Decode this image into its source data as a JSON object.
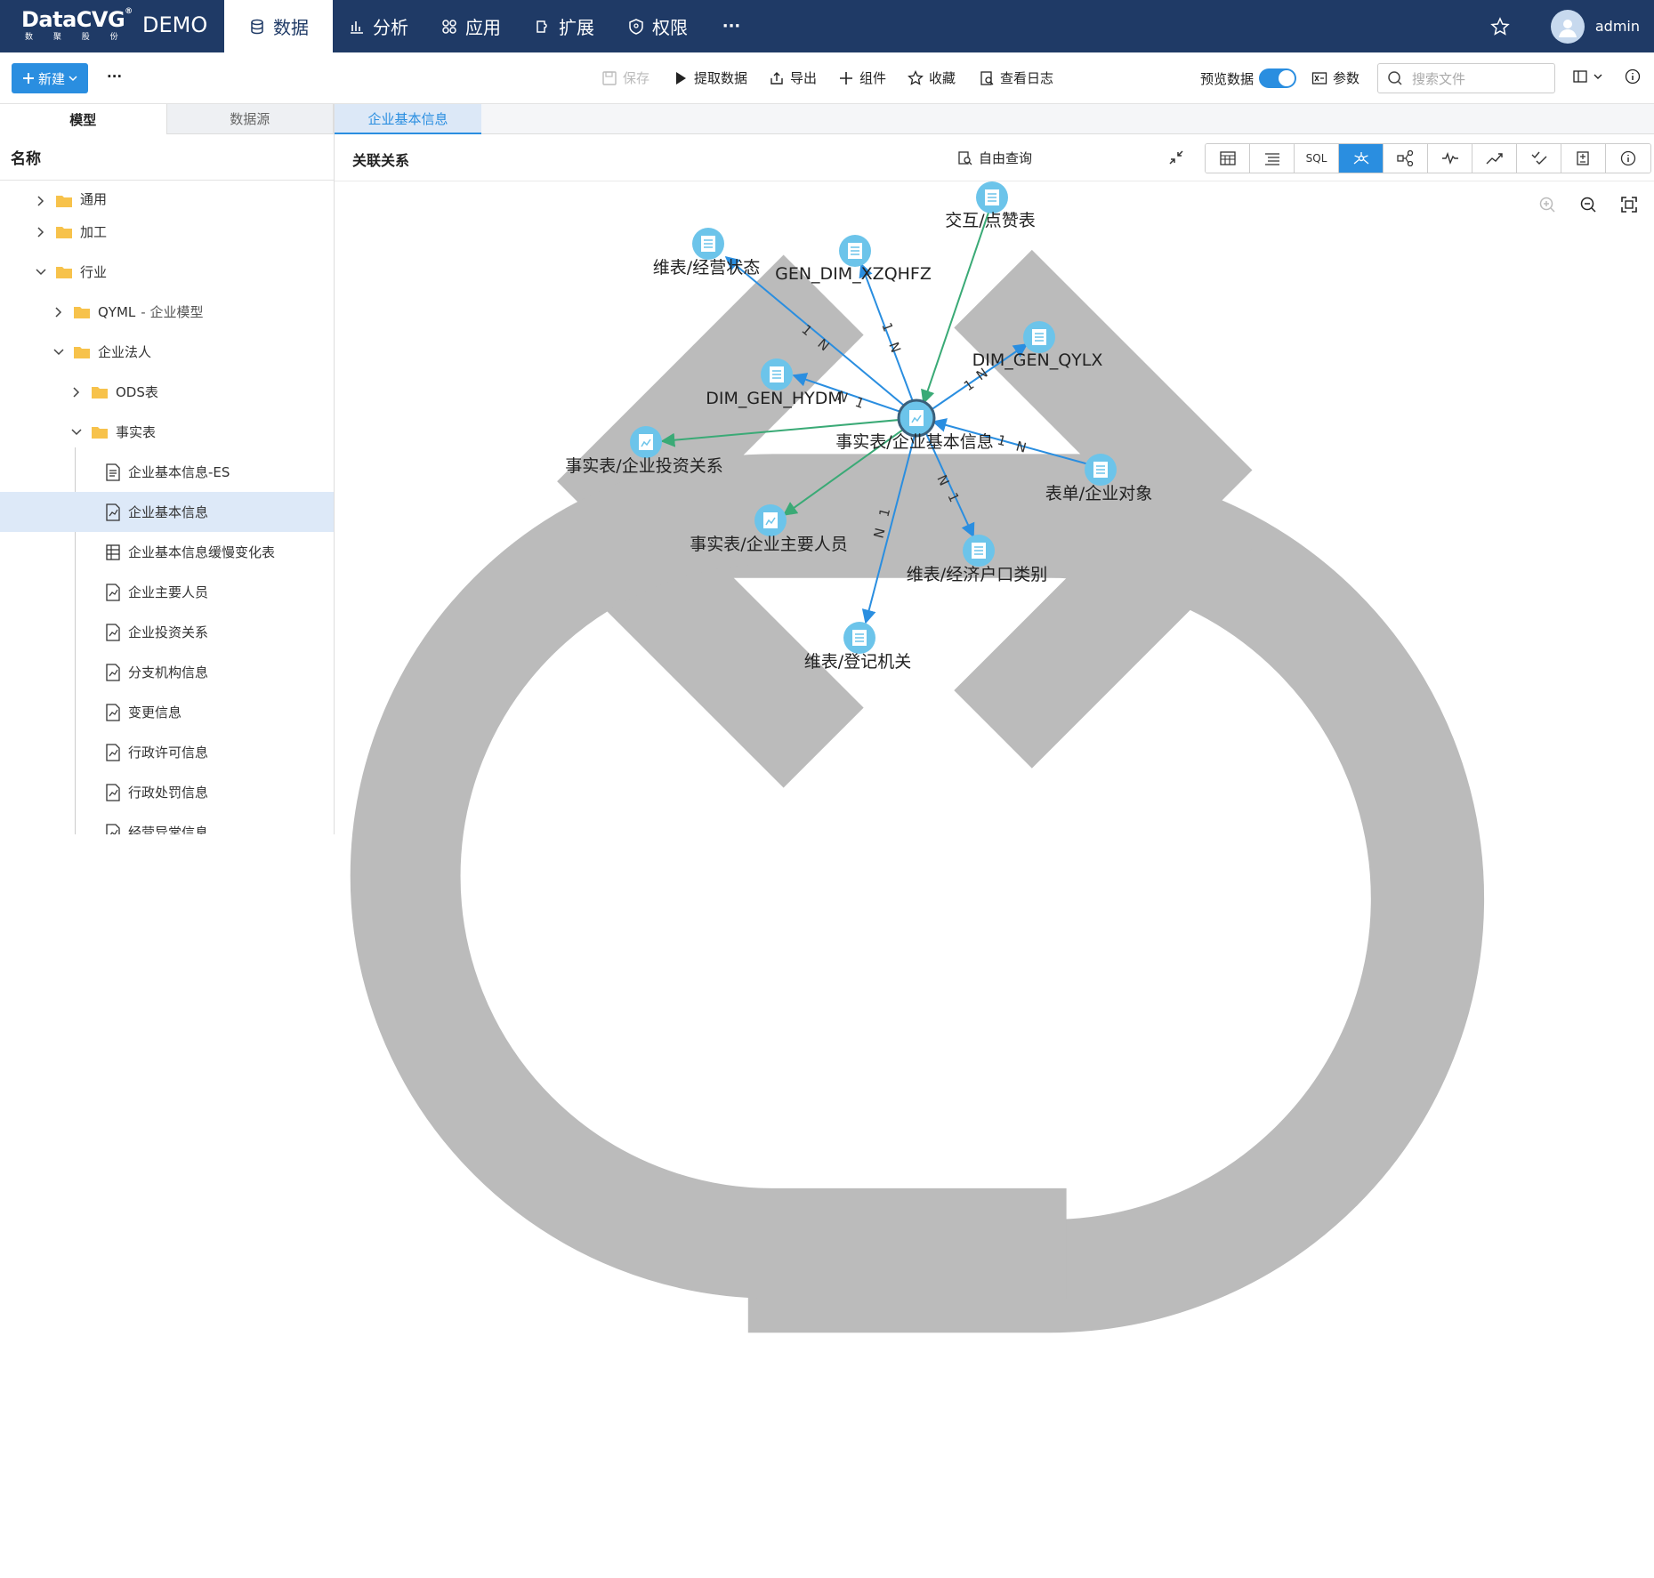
{
  "app": {
    "logo": "DataCVG",
    "logo_sub": "数 聚 股 份",
    "env": "DEMO",
    "nav": [
      {
        "label": "数据",
        "icon": "database-icon"
      },
      {
        "label": "分析",
        "icon": "bar-chart-icon"
      },
      {
        "label": "应用",
        "icon": "apps-icon"
      },
      {
        "label": "扩展",
        "icon": "extension-icon"
      },
      {
        "label": "权限",
        "icon": "shield-icon"
      }
    ],
    "more": "···",
    "user": "admin"
  },
  "toolbar": {
    "new_label": "新建",
    "save": "保存",
    "extract": "提取数据",
    "export": "导出",
    "component": "组件",
    "favorite": "收藏",
    "log": "查看日志",
    "preview": "预览数据",
    "params": "参数",
    "search_placeholder": "搜索文件"
  },
  "sidebar": {
    "tabs": [
      "模型",
      "数据源"
    ],
    "header": "名称",
    "items": [
      {
        "label": "通用"
      },
      {
        "label": "加工"
      },
      {
        "label": "行业"
      },
      {
        "label": "QYML",
        "sub": "- 企业模型"
      },
      {
        "label": "企业法人"
      },
      {
        "label": "ODS表"
      },
      {
        "label": "事实表"
      },
      {
        "label": "企业基本信息-ES"
      },
      {
        "label": "企业基本信息"
      },
      {
        "label": "企业基本信息缓慢变化表"
      },
      {
        "label": "企业主要人员"
      },
      {
        "label": "企业投资关系"
      },
      {
        "label": "分支机构信息"
      },
      {
        "label": "变更信息"
      },
      {
        "label": "行政许可信息"
      },
      {
        "label": "行政处罚信息"
      },
      {
        "label": "经营异常信息"
      }
    ]
  },
  "main": {
    "tab": "企业基本信息",
    "title": "关联关系",
    "free_query": "自由查询",
    "view_sql": "SQL"
  },
  "graph": {
    "center": "事实表/企业基本信息",
    "nodes": [
      "交互/点赞表",
      "维表/经营状态",
      "GEN_DIM_XZQHFZ",
      "DIM_GEN_QYLX",
      "DIM_GEN_HYDM",
      "事实表/企业投资关系",
      "表单/企业对象",
      "事实表/企业主要人员",
      "维表/经济户口类别",
      "维表/登记机关"
    ],
    "edge_labels": {
      "one": "1",
      "many": "N"
    }
  },
  "colors": {
    "topbar": "#1f3a66",
    "accent": "#2a8ee0",
    "node": "#6cc4ea",
    "edge_blue": "#2a8ee0",
    "edge_green": "#3aaa76"
  }
}
